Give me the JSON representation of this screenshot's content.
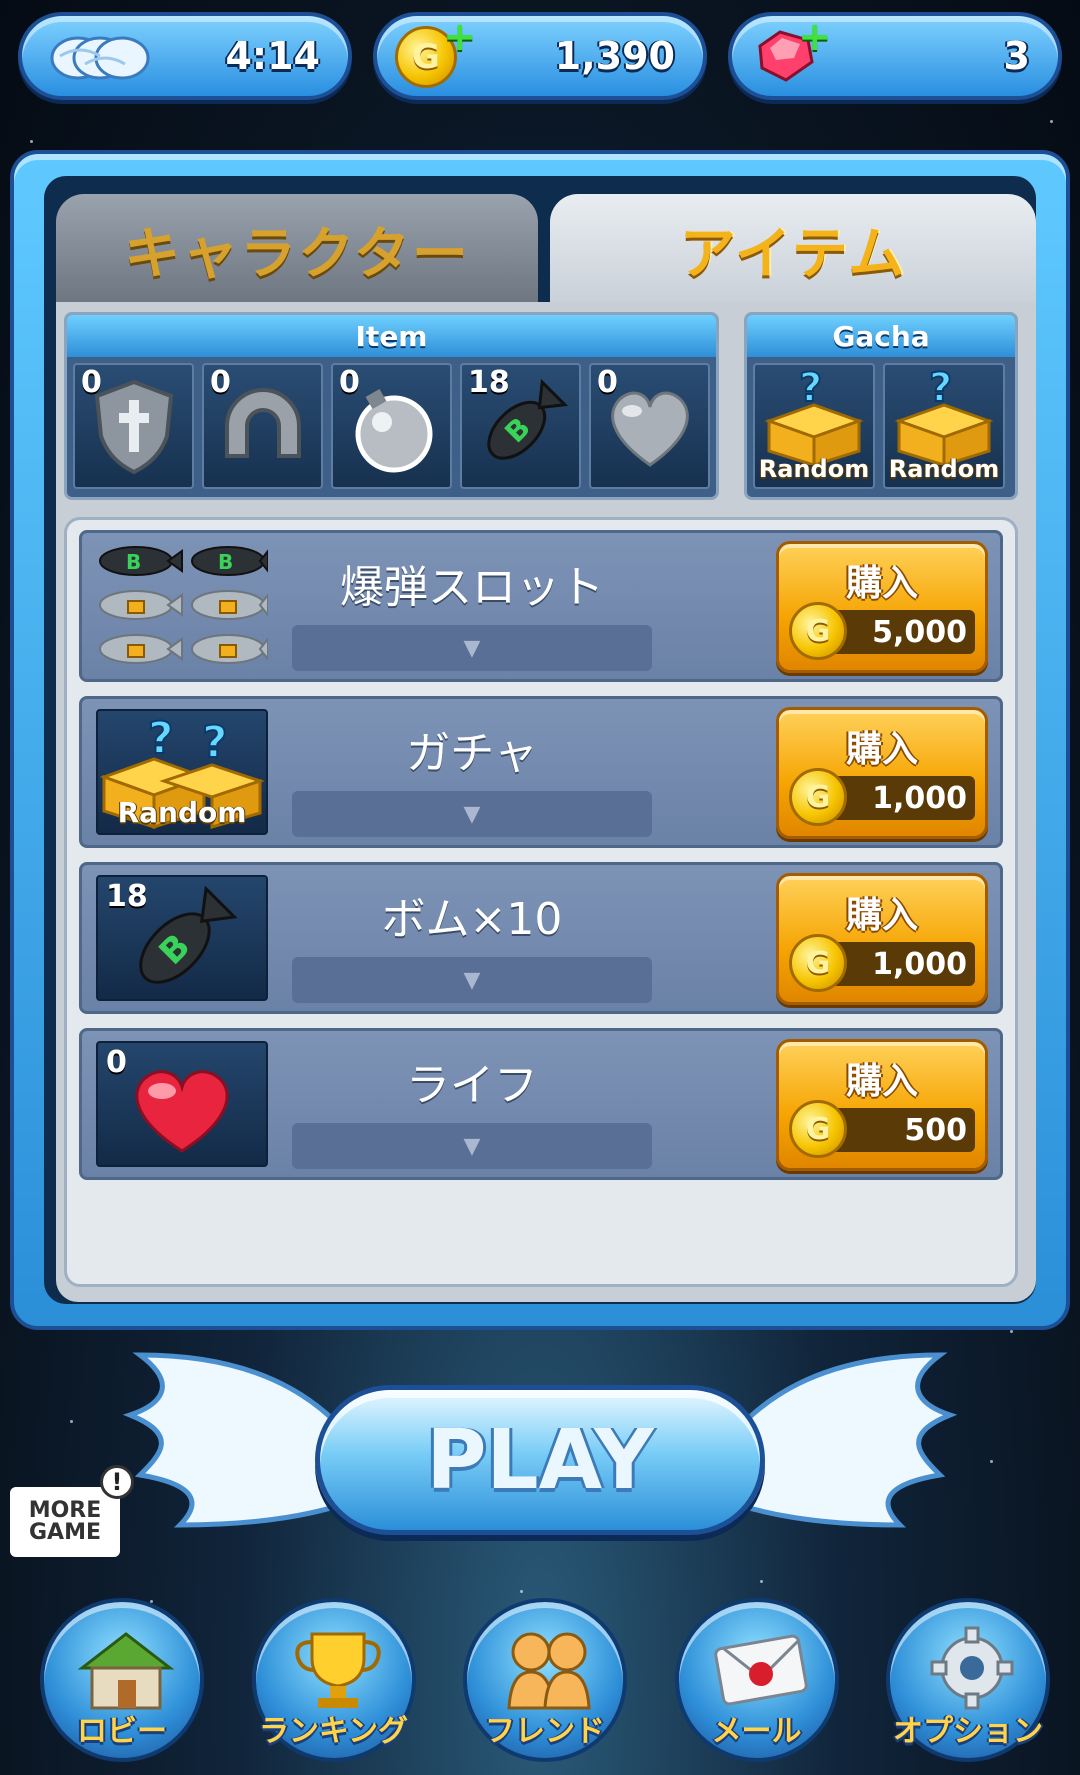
{
  "topbar": {
    "stamina_timer": "4:14",
    "coins": "1,390",
    "gems": "3"
  },
  "tabs": [
    {
      "label": "キャラクター",
      "active": false
    },
    {
      "label": "アイテム",
      "active": true
    }
  ],
  "item_box": {
    "header": "Item",
    "slots": [
      {
        "icon": "shield-icon",
        "count": "0"
      },
      {
        "icon": "magnet-icon",
        "count": "0"
      },
      {
        "icon": "bomb-icon",
        "count": "0"
      },
      {
        "icon": "missile-bomb-icon",
        "count": "18"
      },
      {
        "icon": "heart-icon",
        "count": "0"
      }
    ]
  },
  "gacha_box": {
    "header": "Gacha",
    "slots": [
      {
        "label": "Random"
      },
      {
        "label": "Random"
      }
    ]
  },
  "shop_items": [
    {
      "title": "爆弾スロット",
      "buy_label": "購入",
      "price": "5,000",
      "thumb": "bomb-slots-icon",
      "count": ""
    },
    {
      "title": "ガチャ",
      "buy_label": "購入",
      "price": "1,000",
      "thumb": "gacha-box-icon",
      "count": "",
      "thumb_label": "Random"
    },
    {
      "title": "ボム×10",
      "buy_label": "購入",
      "price": "1,000",
      "thumb": "missile-bomb-icon",
      "count": "18"
    },
    {
      "title": "ライフ",
      "buy_label": "購入",
      "price": "500",
      "thumb": "heart-icon",
      "count": "0"
    }
  ],
  "expand_glyph": "▼",
  "play": {
    "label": "PLAY"
  },
  "more_game": {
    "line1": "MORE",
    "line2": "GAME",
    "badge": "!"
  },
  "nav": [
    {
      "label": "ロビー",
      "icon": "house-icon"
    },
    {
      "label": "ランキング",
      "icon": "trophy-icon"
    },
    {
      "label": "フレンド",
      "icon": "friends-icon"
    },
    {
      "label": "メール",
      "icon": "mail-icon"
    },
    {
      "label": "オプション",
      "icon": "gear-icon"
    }
  ],
  "coin_glyph": "G",
  "colors": {
    "accent_blue": "#2b8fd8",
    "buy_orange": "#f5a300",
    "panel_dark": "#0e2c4d"
  }
}
